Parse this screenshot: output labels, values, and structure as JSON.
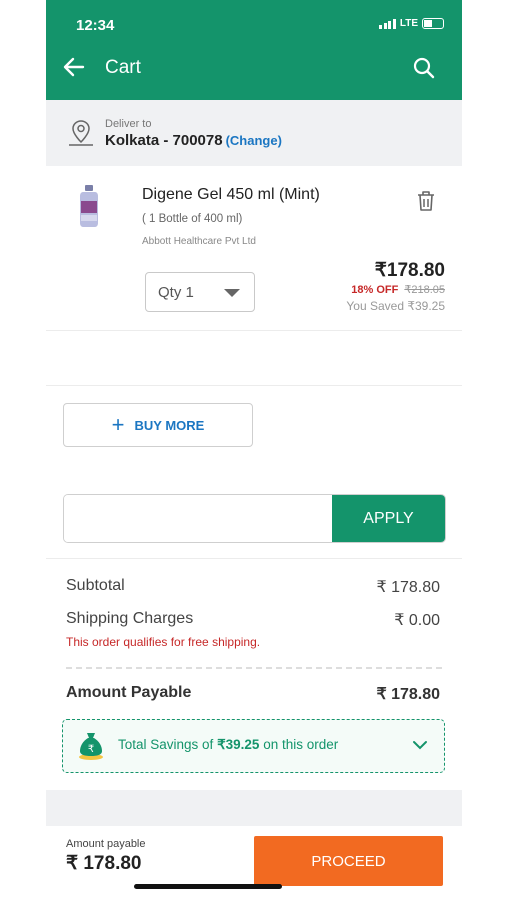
{
  "status_bar": {
    "time": "12:34",
    "network": "LTE"
  },
  "header": {
    "title": "Cart",
    "back_icon": "back-arrow-icon",
    "search_icon": "search-icon"
  },
  "delivery": {
    "label": "Deliver to",
    "location": "Kolkata - 700078",
    "change_label": "(Change)"
  },
  "cart_item": {
    "name": "Digene Gel 450 ml (Mint)",
    "pack_size": "( 1 Bottle of 400 ml)",
    "manufacturer": "Abbott Healthcare Pvt Ltd",
    "quantity_label": "Qty 1",
    "price": "₹178.80",
    "discount": "18% OFF",
    "mrp": "₹218.05",
    "saved": "You Saved ₹39.25"
  },
  "buy_more": {
    "label": "BUY MORE"
  },
  "coupon": {
    "placeholder": "",
    "apply_label": "APPLY"
  },
  "summary": {
    "subtotal_label": "Subtotal",
    "subtotal_value": "₹ 178.80",
    "shipping_label": "Shipping Charges",
    "shipping_value": "₹ 0.00",
    "free_shipping_note": "This order qualifies for free shipping.",
    "payable_label": "Amount Payable",
    "payable_value": "₹ 178.80"
  },
  "savings_banner": {
    "prefix": "Total Savings of ",
    "amount": "₹39.25",
    "suffix": " on this order"
  },
  "footer": {
    "amount_label": "Amount payable",
    "amount_value": "₹ 178.80",
    "proceed_label": "PROCEED"
  },
  "colors": {
    "brand_green": "#14946b",
    "proceed_orange": "#f26a21",
    "link_blue": "#1b76c2",
    "alert_red": "#c62828"
  }
}
